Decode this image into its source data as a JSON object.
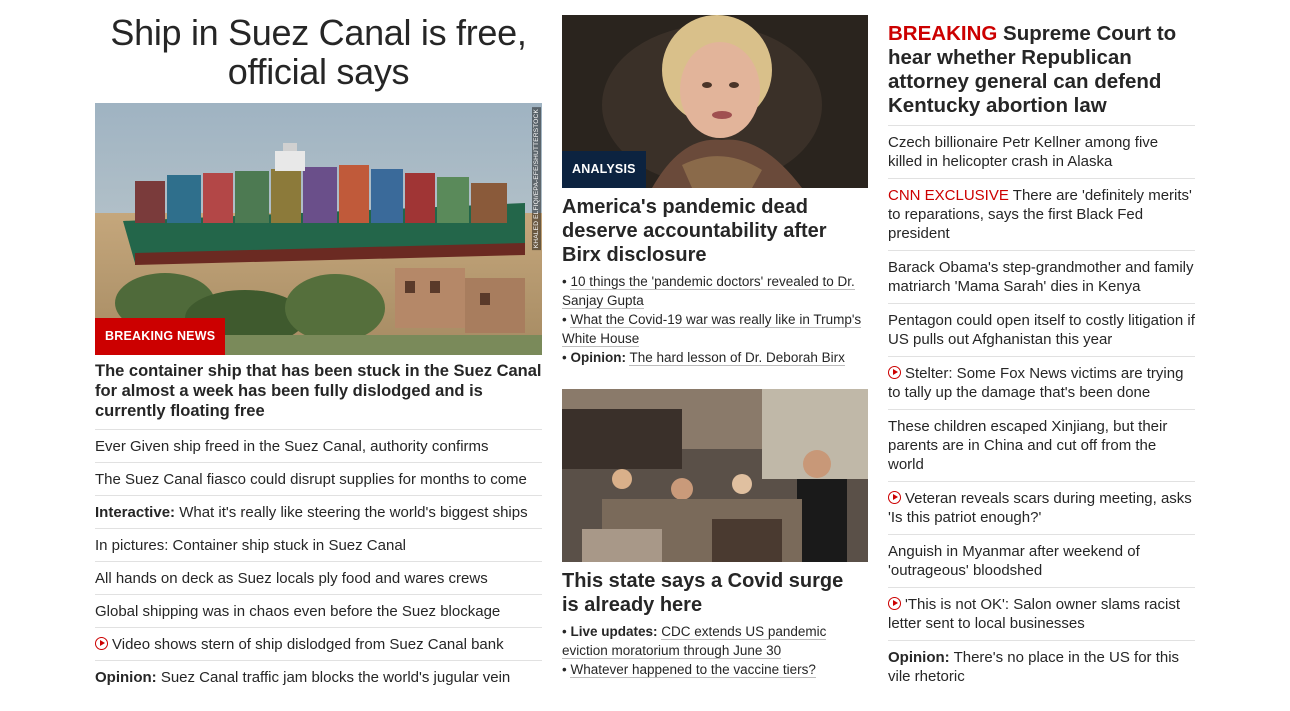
{
  "left": {
    "headline": "Ship in Suez Canal is free, official says",
    "badge": "BREAKING NEWS",
    "photo_credit": "KHALED ELFIQI/EPA-EFE/SHUTTERSTOCK",
    "description": "The container ship that has been stuck in the Suez Canal for almost a week has been fully dislodged and is currently floating free",
    "items": [
      {
        "prefix": "",
        "text": "Ever Given ship freed in the Suez Canal, authority confirms",
        "video": false
      },
      {
        "prefix": "",
        "text": "The Suez Canal fiasco could disrupt supplies for months to come",
        "video": false
      },
      {
        "prefix": "Interactive:",
        "text": "What it's really like steering the world's biggest ships",
        "video": false
      },
      {
        "prefix": "",
        "text": "In pictures: Container ship stuck in Suez Canal",
        "video": false
      },
      {
        "prefix": "",
        "text": "All hands on deck as Suez locals ply food and wares crews",
        "video": false
      },
      {
        "prefix": "",
        "text": "Global shipping was in chaos even before the Suez blockage",
        "video": false
      },
      {
        "prefix": "",
        "text": "Video shows stern of ship dislodged from Suez Canal bank",
        "video": true
      },
      {
        "prefix": "Opinion:",
        "text": "Suez Canal traffic jam blocks the world's jugular vein",
        "video": false
      }
    ]
  },
  "middle": {
    "story1": {
      "badge": "ANALYSIS",
      "headline": "America's pandemic dead deserve accountability after Birx disclosure",
      "bullets": [
        {
          "prefix": "",
          "text": "10 things the 'pandemic doctors' revealed to Dr. Sanjay Gupta"
        },
        {
          "prefix": "",
          "text": "What the Covid-19 war was really like in Trump's White House"
        },
        {
          "prefix": "Opinion:",
          "text": "The hard lesson of Dr. Deborah Birx"
        }
      ]
    },
    "story2": {
      "headline": "This state says a Covid surge is already here",
      "bullets": [
        {
          "prefix": "Live updates:",
          "text": "CDC extends US pandemic eviction moratorium through June 30"
        },
        {
          "prefix": "",
          "text": "Whatever happened to the vaccine tiers?"
        }
      ]
    }
  },
  "right": {
    "breaking_label": "BREAKING",
    "breaking_text": "Supreme Court to hear whether Republican attorney general can defend Kentucky abortion law",
    "items": [
      {
        "prefix": "",
        "red_prefix": "",
        "text": "Czech billionaire Petr Kellner among five killed in helicopter crash in Alaska",
        "video": false
      },
      {
        "prefix": "",
        "red_prefix": "CNN EXCLUSIVE",
        "text": "There are 'definitely merits' to reparations, says the first Black Fed president",
        "video": false
      },
      {
        "prefix": "",
        "red_prefix": "",
        "text": "Barack Obama's step-grandmother and family matriarch 'Mama Sarah' dies in Kenya",
        "video": false
      },
      {
        "prefix": "",
        "red_prefix": "",
        "text": "Pentagon could open itself to costly litigation if US pulls out Afghanistan this year",
        "video": false
      },
      {
        "prefix": "",
        "red_prefix": "",
        "text": "Stelter: Some Fox News victims are trying to tally up the damage that's been done",
        "video": true
      },
      {
        "prefix": "",
        "red_prefix": "",
        "text": "These children escaped Xinjiang, but their parents are in China and cut off from the world",
        "video": false
      },
      {
        "prefix": "",
        "red_prefix": "",
        "text": "Veteran reveals scars during meeting, asks 'Is this patriot enough?'",
        "video": true
      },
      {
        "prefix": "",
        "red_prefix": "",
        "text": "Anguish in Myanmar after weekend of 'outrageous' bloodshed",
        "video": false
      },
      {
        "prefix": "",
        "red_prefix": "",
        "text": "'This is not OK': Salon owner slams racist letter sent to local businesses",
        "video": true
      },
      {
        "prefix": "Opinion:",
        "red_prefix": "",
        "text": "There's no place in the US for this vile rhetoric",
        "video": false
      }
    ]
  },
  "colors": {
    "brand_red": "#cc0000",
    "badge_navy": "#0c2340",
    "text": "#262626",
    "divider": "#e1e1e1"
  }
}
